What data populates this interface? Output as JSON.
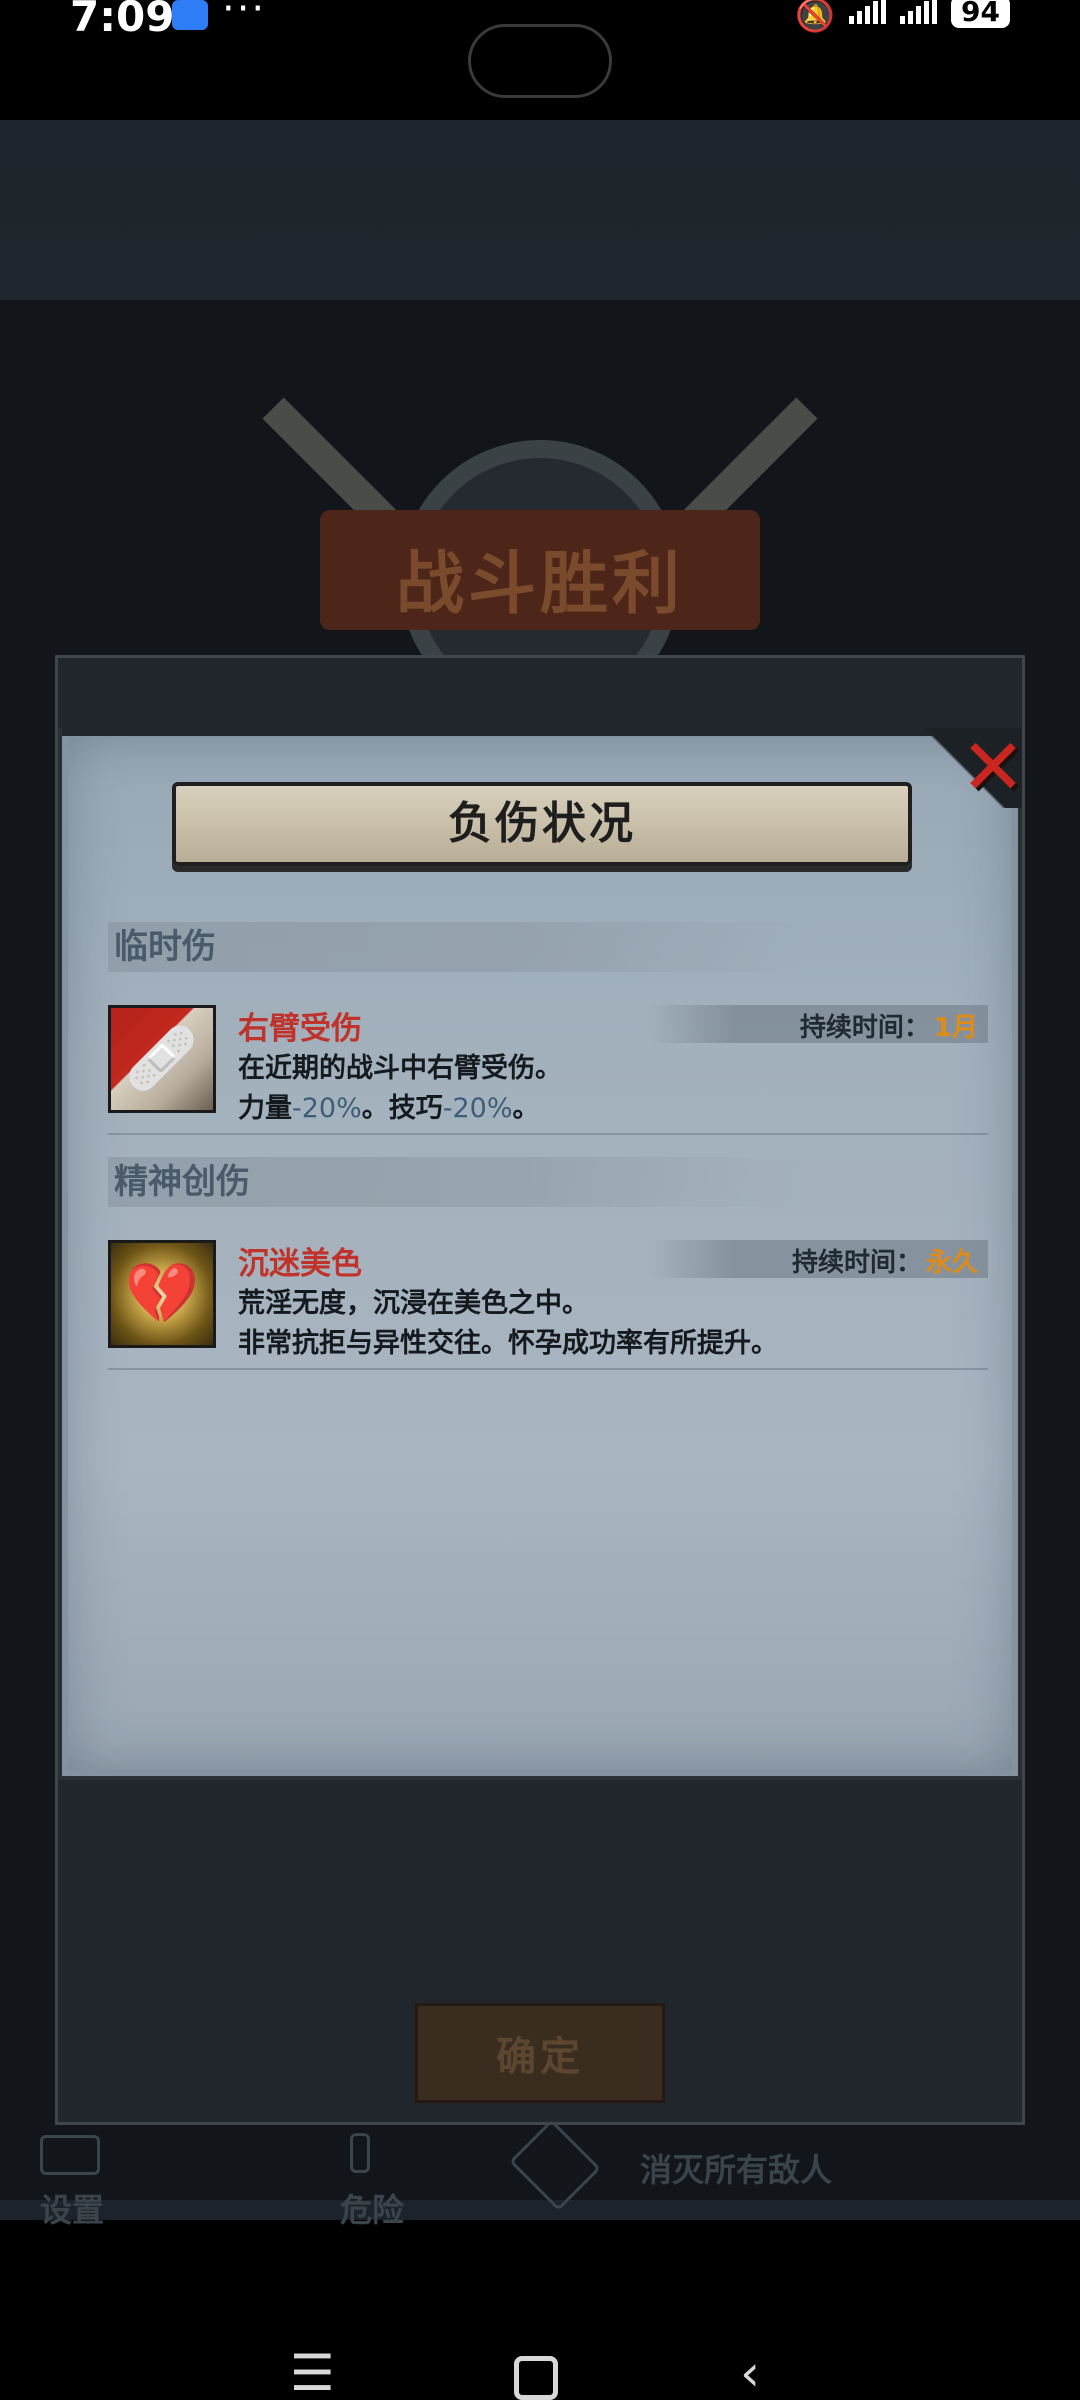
{
  "status_bar": {
    "time": "7:09",
    "dots": "···",
    "battery": "94",
    "icons": [
      "app-notification-icon",
      "mute-icon",
      "signal-5g-icon",
      "signal-5g-icon",
      "battery-icon"
    ]
  },
  "background": {
    "victory_title": "战斗胜利",
    "confirm_label": "确定",
    "hud": {
      "settings": "设置",
      "danger": "危险",
      "objective": "消灭所有敌人"
    }
  },
  "dialog": {
    "title": "负伤状况",
    "close_symbol": "✕",
    "sections": [
      {
        "label": "临时伤",
        "injuries": [
          {
            "name": "右臂受伤",
            "duration_label": "持续时间：",
            "duration_value": "1月",
            "line1": "在近期的战斗中右臂受伤。",
            "line2_prefix": "力量",
            "line2_num1": "-20%",
            "line2_mid": "。技巧",
            "line2_num2": "-20%",
            "line2_suffix": "。"
          }
        ]
      },
      {
        "label": "精神创伤",
        "injuries": [
          {
            "name": "沉迷美色",
            "duration_label": "持续时间：",
            "duration_value": "永久",
            "line1": "荒淫无度，沉浸在美色之中。",
            "line2": "非常抗拒与异性交往。怀孕成功率有所提升。"
          }
        ]
      }
    ]
  },
  "colors": {
    "injury_name": "#c0332b",
    "duration_value": "#e08c14",
    "close_x": "#c9261f"
  }
}
